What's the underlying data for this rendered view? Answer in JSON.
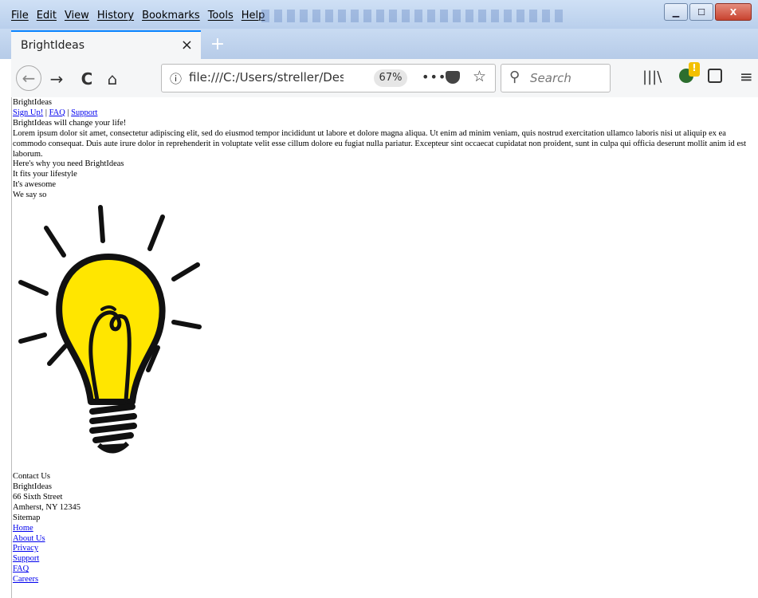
{
  "browser": {
    "menu": [
      "File",
      "Edit",
      "View",
      "History",
      "Bookmarks",
      "Tools",
      "Help"
    ],
    "tab_title": "BrightIdeas",
    "tab_close": "×",
    "new_tab": "+",
    "url": "file:///C:/Users/streller/Deskto",
    "zoom": "67%",
    "search_placeholder": "Search",
    "icons": [
      "back-icon",
      "forward-icon",
      "reload-icon",
      "home-icon",
      "info-icon",
      "page-actions-icon",
      "pocket-icon",
      "bookmark-star-icon",
      "search-icon",
      "library-icon",
      "extension-icon",
      "sidebar-icon",
      "hamburger-menu-icon"
    ]
  },
  "page": {
    "brand": "BrightIdeas",
    "nav": [
      {
        "label": "Sign Up!"
      },
      {
        "label": "FAQ"
      },
      {
        "label": "Support"
      }
    ],
    "nav_separator": "|",
    "headline": "BrightIdeas will change your life!",
    "lorem": "Lorem ipsum dolor sit amet, consectetur adipiscing elit, sed do eiusmod tempor incididunt ut labore et dolore magna aliqua. Ut enim ad minim veniam, quis nostrud exercitation ullamco laboris nisi ut aliquip ex ea commodo consequat. Duis aute irure dolor in reprehenderit in voluptate velit esse cillum dolore eu fugiat nulla pariatur. Excepteur sint occaecat cupidatat non proident, sunt in culpa qui officia deserunt mollit anim id est laborum.",
    "why_heading": "Here's why you need BrightIdeas",
    "reasons": [
      "It fits your lifestyle",
      "It's awesome",
      "We say so"
    ],
    "image": "lightbulb-illustration",
    "contact": {
      "heading": "Contact Us",
      "name": "BrightIdeas",
      "street": "66 Sixth Street",
      "city": "Amherst, NY 12345"
    },
    "sitemap": {
      "heading": "Sitemap",
      "links": [
        "Home",
        "About Us",
        "Privacy",
        "Support",
        "FAQ",
        "Careers"
      ]
    }
  },
  "colors": {
    "bulb_yellow": "#ffe600",
    "link": "#0000ee",
    "tab_accent": "#0a84ff"
  }
}
